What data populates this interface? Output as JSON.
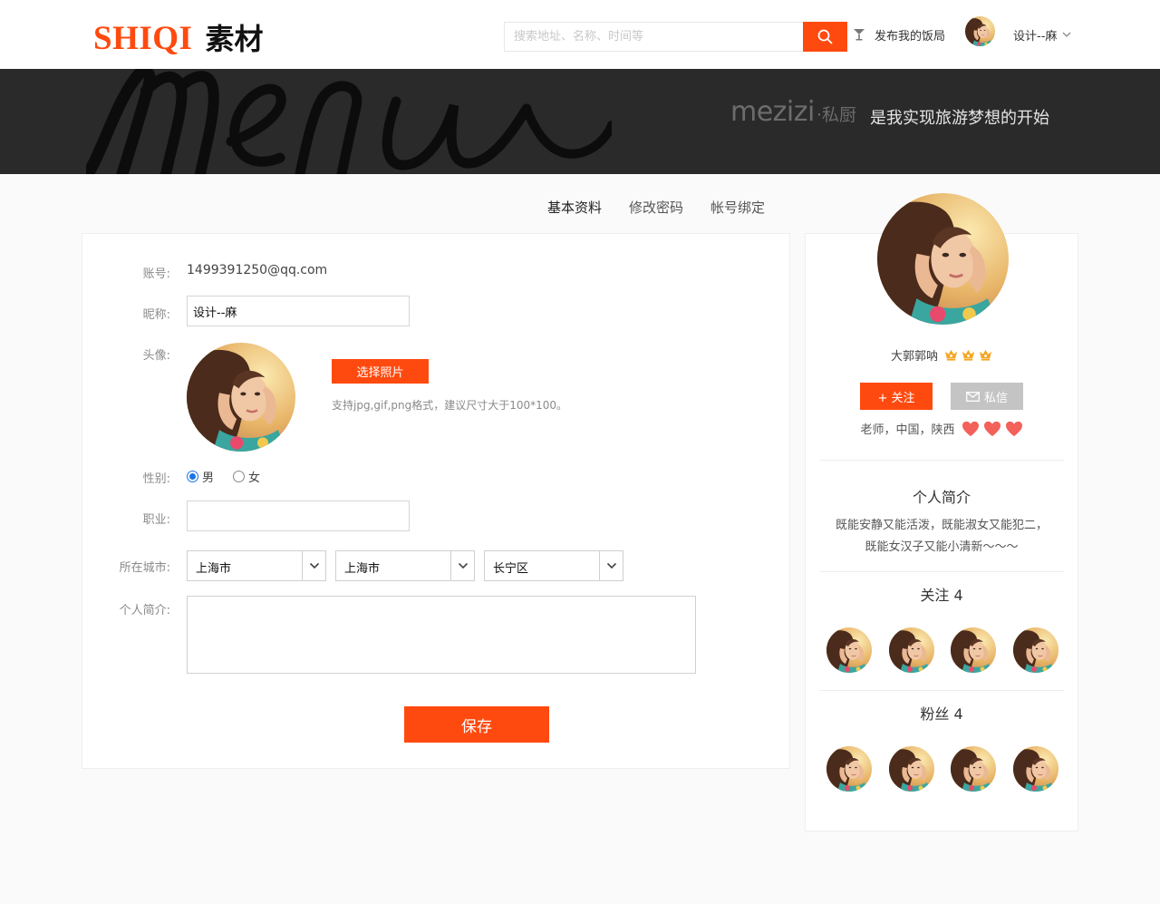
{
  "header": {
    "logo_en": "SHIQI",
    "logo_cn": "素材",
    "search_placeholder": "搜索地址、名称、时间等",
    "publish_label": "发布我的饭局",
    "username": "设计--麻"
  },
  "banner": {
    "script_word": "Menu",
    "brand_en": "mezizi",
    "brand_cn": "·私厨",
    "slogan": "是我实现旅游梦想的开始"
  },
  "tabs": [
    {
      "label": "基本资料",
      "active": true
    },
    {
      "label": "修改密码",
      "active": false
    },
    {
      "label": "帐号绑定",
      "active": false
    }
  ],
  "form": {
    "account_label": "账号:",
    "account_value": "1499391250@qq.com",
    "nickname_label": "昵称:",
    "nickname_value": "设计--麻",
    "avatar_label": "头像:",
    "choose_photo": "选择照片",
    "photo_hint": "支持jpg,gif,png格式，建议尺寸大于100*100。",
    "gender_label": "性别:",
    "gender_male": "男",
    "gender_female": "女",
    "gender_selected": "男",
    "job_label": "职业:",
    "job_value": "",
    "city_label": "所在城市:",
    "province": "上海市",
    "city": "上海市",
    "district": "长宁区",
    "bio_label": "个人简介:",
    "bio_value": "",
    "save": "保存"
  },
  "profile": {
    "name": "大郭郭呐",
    "crown_count": 3,
    "follow": "+ 关注",
    "message": "私信",
    "location": "老师，中国，陕西",
    "heart_count": 3,
    "bio_title": "个人简介",
    "bio_line1": "既能安静又能活泼，既能淑女又能犯二，",
    "bio_line2": "既能女汉子又能小清新～～～",
    "following_title": "关注 4",
    "followers_title": "粉丝 4"
  },
  "colors": {
    "accent": "#ff4a0f",
    "banner_bg": "#2a2a2a",
    "heart": "#f4615a",
    "crown": "#f5a623"
  }
}
